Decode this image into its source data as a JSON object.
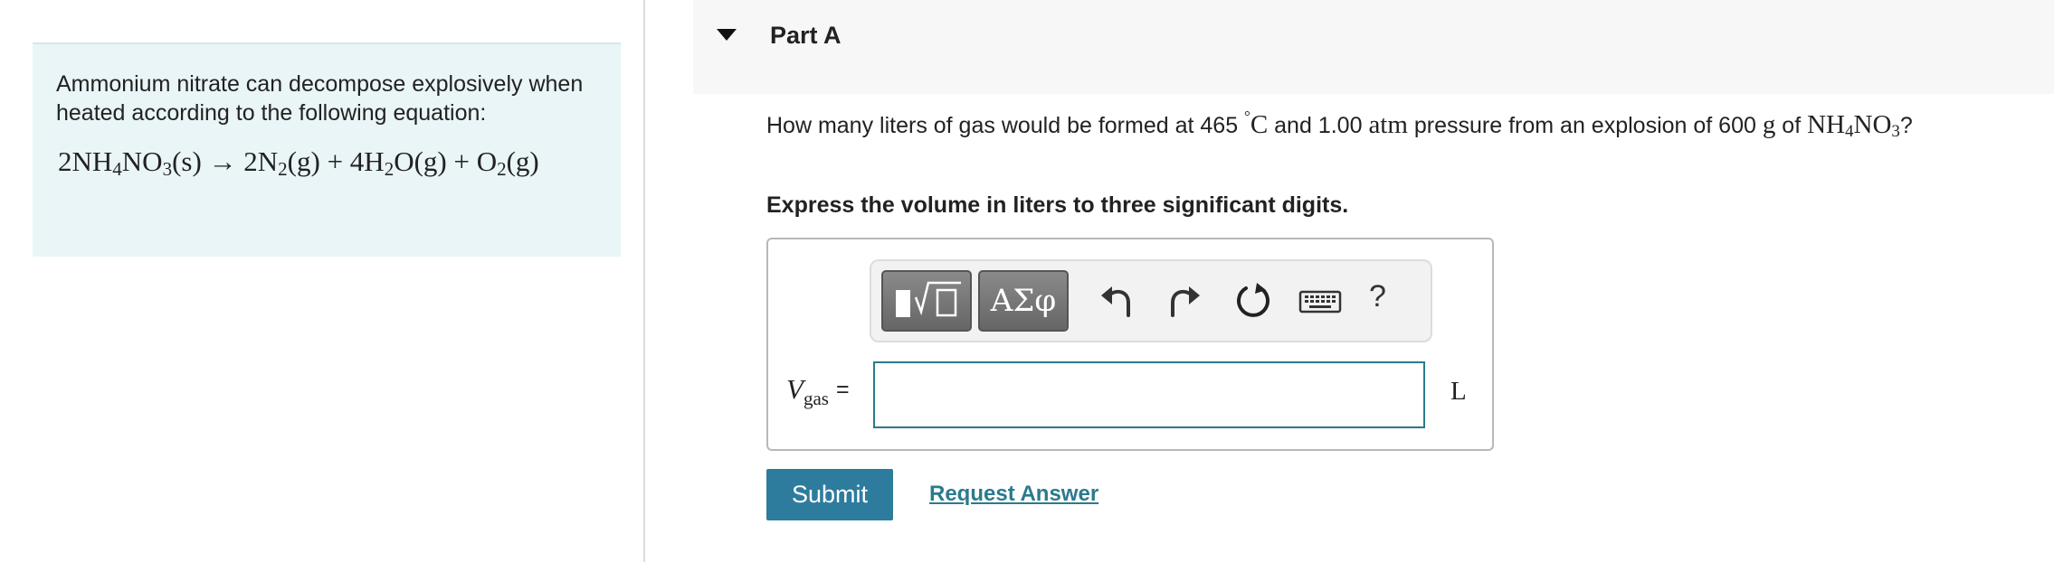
{
  "intro": {
    "text": "Ammonium nitrate can decompose explosively when heated according to the following equation:",
    "equation": {
      "lhs_coef": "2NH",
      "lhs_sub1": "4",
      "lhs_mid": "NO",
      "lhs_sub2": "3",
      "lhs_state": "(s) → 2N",
      "n2_sub": "2",
      "n2_state": "(g) + 4H",
      "h2o_sub": "2",
      "h2o_rest": "O(g) + O",
      "o2_sub": "2",
      "o2_state": "(g)"
    }
  },
  "part": {
    "title": "Part A",
    "toggle_icon": "caret-down-icon"
  },
  "question": {
    "prefix": "How many liters of gas would be formed at 465",
    "degree": "°",
    "temp_unit": "C",
    "middle": "and 1.00",
    "pressure_unit": "atm",
    "pressure_text": "pressure from an explosion of 600",
    "mass_unit": "g",
    "of": "of",
    "formula_a": "NH",
    "formula_sub1": "4",
    "formula_b": "NO",
    "formula_sub2": "3",
    "end": "?"
  },
  "instruction": "Express the volume in liters to three significant digits.",
  "toolbar": {
    "templates_icon": "math-templates-icon",
    "symbols_label": "ΑΣφ",
    "undo_icon": "undo-icon",
    "redo_icon": "redo-icon",
    "reset_icon": "reset-icon",
    "keyboard_icon": "keyboard-icon",
    "help_label": "?"
  },
  "answer": {
    "variable": "V",
    "variable_sub": "gas",
    "equals": "=",
    "value": "",
    "unit": "L"
  },
  "actions": {
    "submit_label": "Submit",
    "request_answer_label": "Request Answer"
  },
  "colors": {
    "intro_bg": "#e9f5f6",
    "accent": "#2e7c9d",
    "link": "#2b7a8e",
    "header_bg": "#f7f7f7"
  }
}
